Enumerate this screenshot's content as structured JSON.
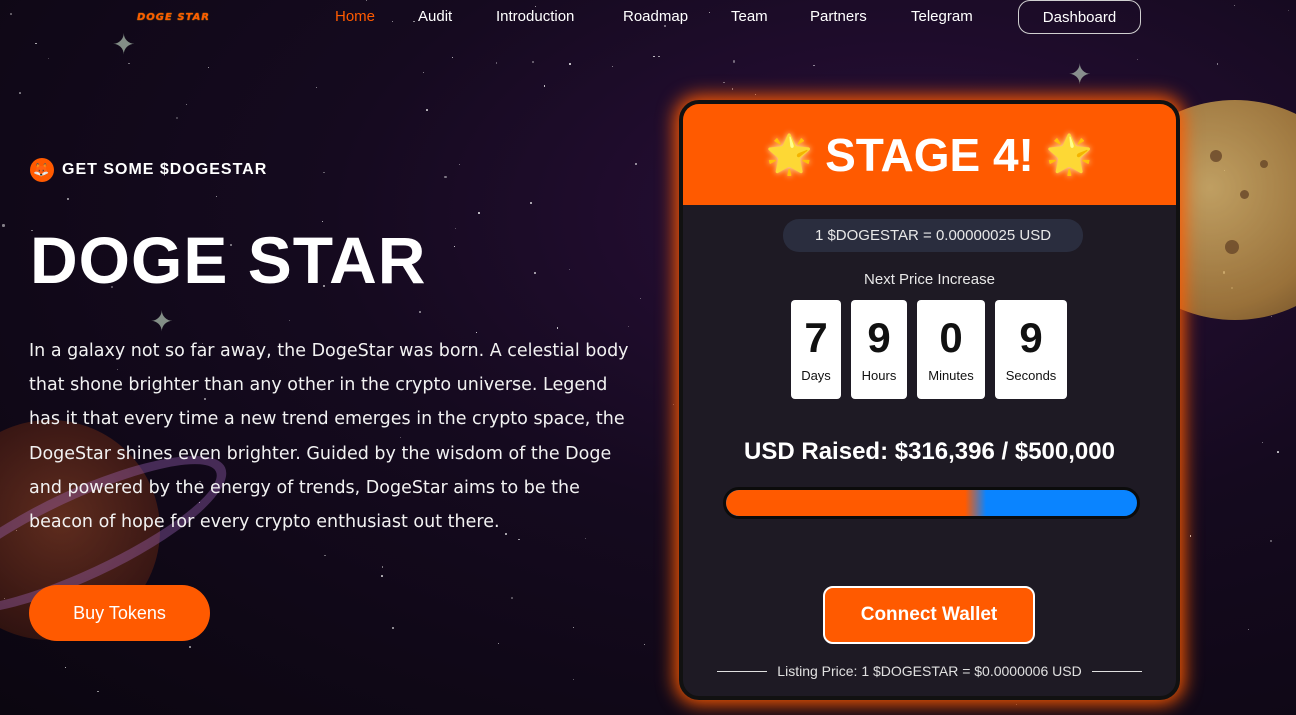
{
  "nav": {
    "logo": "DOGE STAR",
    "items": [
      {
        "label": "Home",
        "active": true
      },
      {
        "label": "Audit",
        "active": false
      },
      {
        "label": "Introduction",
        "active": false
      },
      {
        "label": "Roadmap",
        "active": false
      },
      {
        "label": "Team",
        "active": false
      },
      {
        "label": "Partners",
        "active": false
      },
      {
        "label": "Telegram",
        "active": false
      }
    ],
    "dashboard_label": "Dashboard"
  },
  "hero": {
    "tagline": "GET SOME $DOGESTAR",
    "tagline_icon": "fox-icon",
    "title": "DOGE STAR",
    "description": "In a galaxy not so far away, the DogeStar was born. A celestial body that shone brighter than any other in the crypto universe. Legend has it that every time a new trend emerges in the crypto space, the DogeStar shines even brighter. Guided by the wisdom of the Doge and powered by the energy of trends, DogeStar aims to be the beacon of hope for every crypto enthusiast out there.",
    "buy_label": "Buy Tokens"
  },
  "presale": {
    "stage_label": "STAGE 4!",
    "stage_icon": "glowing-star-icon",
    "rate": "1 $DOGESTAR = 0.00000025 USD",
    "next_price_label": "Next Price Increase",
    "countdown": [
      {
        "value": "7",
        "unit": "Days"
      },
      {
        "value": "9",
        "unit": "Hours"
      },
      {
        "value": "0",
        "unit": "Minutes"
      },
      {
        "value": "9",
        "unit": "Seconds"
      }
    ],
    "raised_text": "USD Raised: $316,396 / $500,000",
    "progress_fraction": 0.633,
    "connect_label": "Connect Wallet",
    "listing_text": "Listing Price: 1 $DOGESTAR = $0.0000006 USD"
  },
  "colors": {
    "accent": "#ff5a00",
    "progress_remaining": "#0a84ff",
    "card_bg": "#1e1a24"
  }
}
